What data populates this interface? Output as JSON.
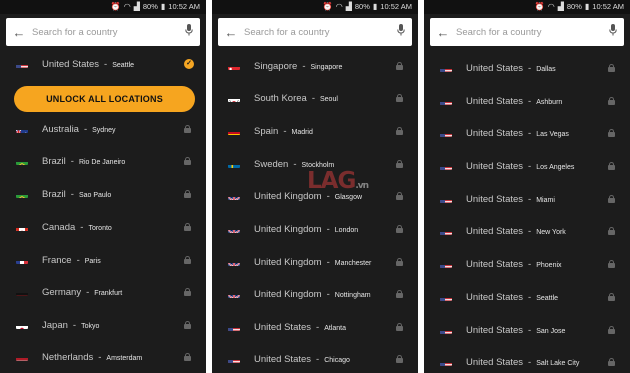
{
  "status_bar": {
    "battery": "80%",
    "time": "10:52 AM"
  },
  "search": {
    "placeholder": "Search for a country"
  },
  "unlock_button": {
    "label": "UNLOCK ALL LOCATIONS"
  },
  "watermark": {
    "text": "LAG",
    "suffix": ".vn"
  },
  "panels": [
    {
      "rows": [
        {
          "country": "United States",
          "city": "Seattle",
          "flag": "us",
          "status": "selected"
        },
        {
          "country": "Australia",
          "city": "Sydney",
          "flag": "au",
          "status": "locked"
        },
        {
          "country": "Brazil",
          "city": "Rio De Janeiro",
          "flag": "br",
          "status": "locked"
        },
        {
          "country": "Brazil",
          "city": "Sao Paulo",
          "flag": "br",
          "status": "locked"
        },
        {
          "country": "Canada",
          "city": "Toronto",
          "flag": "ca",
          "status": "locked"
        },
        {
          "country": "France",
          "city": "Paris",
          "flag": "fr",
          "status": "locked"
        },
        {
          "country": "Germany",
          "city": "Frankfurt",
          "flag": "de",
          "status": "locked"
        },
        {
          "country": "Japan",
          "city": "Tokyo",
          "flag": "jp",
          "status": "locked"
        },
        {
          "country": "Netherlands",
          "city": "Amsterdam",
          "flag": "nl",
          "status": "locked"
        }
      ]
    },
    {
      "rows": [
        {
          "country": "Singapore",
          "city": "Singapore",
          "flag": "sg",
          "status": "locked"
        },
        {
          "country": "South Korea",
          "city": "Seoul",
          "flag": "kr",
          "status": "locked"
        },
        {
          "country": "Spain",
          "city": "Madrid",
          "flag": "es",
          "status": "locked"
        },
        {
          "country": "Sweden",
          "city": "Stockholm",
          "flag": "se",
          "status": "locked"
        },
        {
          "country": "United Kingdom",
          "city": "Glasgow",
          "flag": "gb",
          "status": "locked"
        },
        {
          "country": "United Kingdom",
          "city": "London",
          "flag": "gb",
          "status": "locked"
        },
        {
          "country": "United Kingdom",
          "city": "Manchester",
          "flag": "gb",
          "status": "locked"
        },
        {
          "country": "United Kingdom",
          "city": "Nottingham",
          "flag": "gb",
          "status": "locked"
        },
        {
          "country": "United States",
          "city": "Atlanta",
          "flag": "us",
          "status": "locked"
        },
        {
          "country": "United States",
          "city": "Chicago",
          "flag": "us",
          "status": "locked"
        }
      ]
    },
    {
      "rows": [
        {
          "country": "United States",
          "city": "Dallas",
          "flag": "us",
          "status": "locked"
        },
        {
          "country": "United States",
          "city": "Ashburn",
          "flag": "us",
          "status": "locked"
        },
        {
          "country": "United States",
          "city": "Las Vegas",
          "flag": "us",
          "status": "locked"
        },
        {
          "country": "United States",
          "city": "Los Angeles",
          "flag": "us",
          "status": "locked"
        },
        {
          "country": "United States",
          "city": "Miami",
          "flag": "us",
          "status": "locked"
        },
        {
          "country": "United States",
          "city": "New York",
          "flag": "us",
          "status": "locked"
        },
        {
          "country": "United States",
          "city": "Phoenix",
          "flag": "us",
          "status": "locked"
        },
        {
          "country": "United States",
          "city": "Seattle",
          "flag": "us",
          "status": "locked"
        },
        {
          "country": "United States",
          "city": "San Jose",
          "flag": "us",
          "status": "locked"
        },
        {
          "country": "United States",
          "city": "Salt Lake City",
          "flag": "us",
          "status": "locked"
        }
      ]
    }
  ]
}
